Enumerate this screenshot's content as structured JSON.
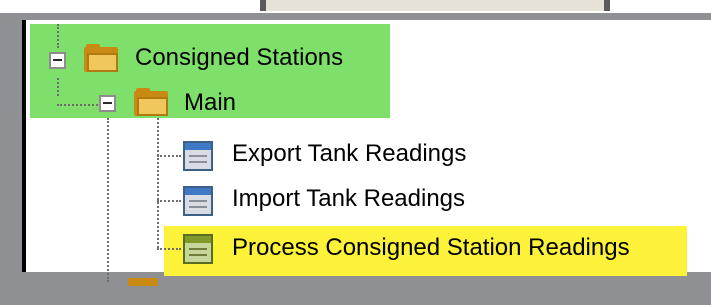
{
  "tree": {
    "root": {
      "label": "Consigned Stations",
      "icon": "folder-open-icon",
      "expanded": true,
      "children": [
        {
          "label": "Main",
          "icon": "folder-open-icon",
          "expanded": true,
          "children": [
            {
              "label": "Export Tank Readings",
              "icon": "report-icon"
            },
            {
              "label": "Import Tank Readings",
              "icon": "report-icon"
            },
            {
              "label": "Process Consigned Station Readings",
              "icon": "report-icon"
            }
          ]
        }
      ]
    }
  },
  "colors": {
    "green_highlight": "#7ee06a",
    "yellow_highlight": "#fcf23a",
    "frame": "#8f9093"
  }
}
